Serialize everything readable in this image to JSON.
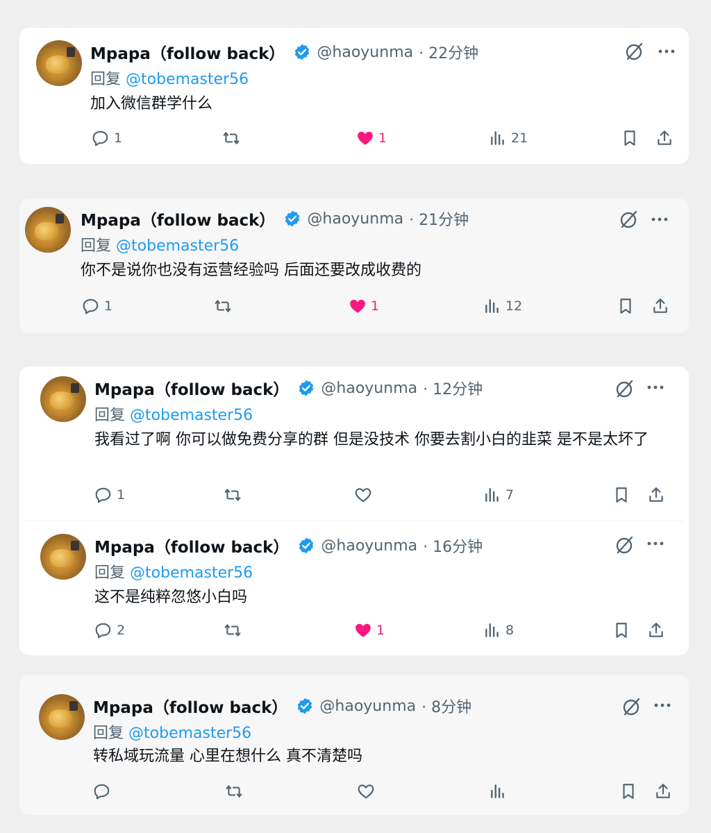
{
  "author": {
    "name": "Mpapa（follow back）",
    "handle": "@haoyunma",
    "reply_prefix": "回复",
    "reply_to": "@tobemaster56"
  },
  "tweets": [
    {
      "time": "· 22分钟",
      "text": "加入微信群学什么",
      "replies": "1",
      "retweets": "",
      "likes": "1",
      "liked": true,
      "views": "21"
    },
    {
      "time": "· 21分钟",
      "text": "你不是说你也没有运营经验吗 后面还要改成收费的",
      "replies": "1",
      "retweets": "",
      "likes": "1",
      "liked": true,
      "views": "12"
    },
    {
      "time": "· 12分钟",
      "text": "我看过了啊 你可以做免费分享的群 但是没技术 你要去割小白的韭菜 是不是太坏了",
      "replies": "1",
      "retweets": "",
      "likes": "",
      "liked": false,
      "views": "7"
    },
    {
      "time": "· 16分钟",
      "text": "这不是纯粹忽悠小白吗",
      "replies": "2",
      "retweets": "",
      "likes": "1",
      "liked": true,
      "views": "8"
    },
    {
      "time": "· 8分钟",
      "text": "转私域玩流量 心里在想什么 真不清楚吗",
      "replies": "",
      "retweets": "",
      "likes": "",
      "liked": false,
      "views": ""
    }
  ],
  "colors": {
    "accent": "#1d9bf0",
    "like": "#f91880",
    "muted": "#536471"
  }
}
